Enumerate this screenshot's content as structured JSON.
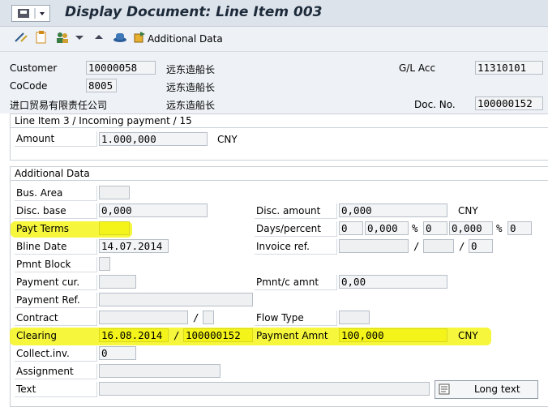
{
  "window": {
    "title": "Display Document: Line Item 003"
  },
  "toolbar": {
    "additional_data_label": "Additional Data"
  },
  "header": {
    "customer_label": "Customer",
    "customer_value": "10000058",
    "customer_name": "远东造船长",
    "cocode_label": "CoCode",
    "cocode_value": "8005",
    "cocode_name": "远东造船长",
    "company_text": "进口贸易有限责任公司",
    "company_name2": "远东造船长",
    "glacc_label": "G/L Acc",
    "glacc_value": "11310101",
    "docno_label": "Doc. No.",
    "docno_value": "100000152"
  },
  "line_item": {
    "title": "Line Item 3 / Incoming payment / 15",
    "amount_label": "Amount",
    "amount_value": "1.000,000",
    "currency": "CNY"
  },
  "additional": {
    "title": "Additional Data",
    "bus_area_label": "Bus. Area",
    "bus_area_value": "",
    "disc_base_label": "Disc. base",
    "disc_base_value": "0,000",
    "disc_amount_label": "Disc. amount",
    "disc_amount_value": "0,000",
    "disc_amount_currency": "CNY",
    "payt_terms_label": "Payt Terms",
    "payt_terms_value": "",
    "days_percent_label": "Days/percent",
    "days1": "0",
    "pct1": "0,000",
    "pct_sign1": "%",
    "days2": "0",
    "pct2": "0,000",
    "pct_sign2": "%",
    "days3": "0",
    "bline_date_label": "Bline Date",
    "bline_date_value": "14.07.2014",
    "invoice_ref_label": "Invoice ref.",
    "invoice_ref_value": "",
    "invoice_ref_sep1": "/",
    "invoice_ref_sep2": "/",
    "invoice_ref_item": "0",
    "pmnt_block_label": "Pmnt Block",
    "pmnt_block_value": "",
    "payment_cur_label": "Payment cur.",
    "payment_cur_value": "",
    "pmnt_c_amnt_label": "Pmnt/c amnt",
    "pmnt_c_amnt_value": "0,00",
    "payment_ref_label": "Payment Ref.",
    "payment_ref_value": "",
    "contract_label": "Contract",
    "contract_sep": "/",
    "flow_type_label": "Flow Type",
    "flow_type_value": "",
    "clearing_label": "Clearing",
    "clearing_date": "16.08.2014",
    "clearing_sep": "/",
    "clearing_doc": "100000152",
    "payment_amnt_label": "Payment Amnt",
    "payment_amnt_value": "100,000",
    "payment_amnt_currency": "CNY",
    "collect_inv_label": "Collect.inv.",
    "collect_inv_value": "0",
    "assignment_label": "Assignment",
    "assignment_value": "",
    "text_label": "Text",
    "text_value": "",
    "long_text_button": "Long text"
  },
  "colors": {
    "highlight": "#f4f41a",
    "title_text": "#1c2a3a"
  }
}
